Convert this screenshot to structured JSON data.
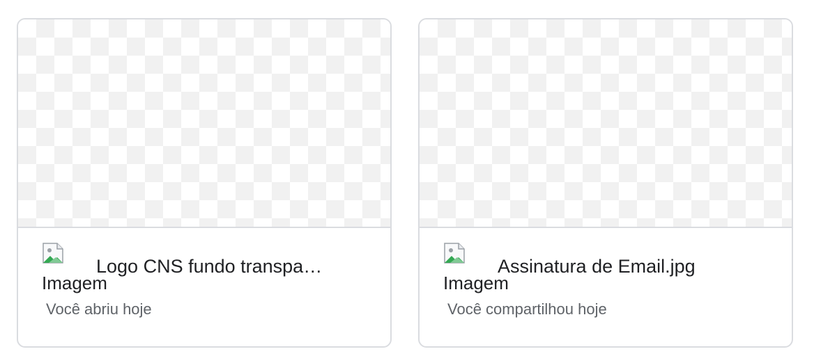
{
  "cards": [
    {
      "title": "Logo CNS fundo transpa…",
      "icon_alt": "Imagem",
      "icon": "broken-image-icon",
      "activity": "Você abriu hoje"
    },
    {
      "title": "Assinatura de Email.jpg",
      "icon_alt": "Imagem",
      "icon": "broken-image-icon",
      "activity": "Você compartilhou hoje"
    }
  ],
  "colors": {
    "border": "#dadce0",
    "title_text": "#202124",
    "subtitle_text": "#5f6368",
    "checker": "#f1f1f1"
  }
}
